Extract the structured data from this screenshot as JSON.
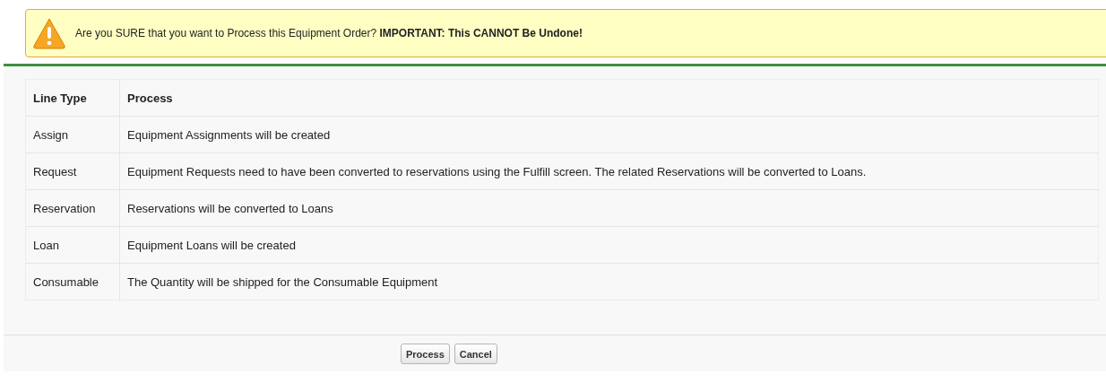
{
  "warning": {
    "message": "Are you SURE that you want to Process this Equipment Order? **IMPORTANT: This CANNOT Be Undone!**"
  },
  "table": {
    "columns": [
      "Line Type",
      "Process"
    ],
    "rows": [
      {
        "line_type": "Assign",
        "process": "Equipment Assignments will be created"
      },
      {
        "line_type": "Request",
        "process": "Equipment Requests need to have been converted to reservations using the Fulfill screen. The related Reservations will be converted to Loans."
      },
      {
        "line_type": "Reservation",
        "process": "Reservations will be converted to Loans"
      },
      {
        "line_type": "Loan",
        "process": "Equipment Loans will be created"
      },
      {
        "line_type": "Consumable",
        "process": "The Quantity will be shipped for the Consumable Equipment"
      }
    ]
  },
  "buttons": [
    "Process",
    "Cancel"
  ]
}
